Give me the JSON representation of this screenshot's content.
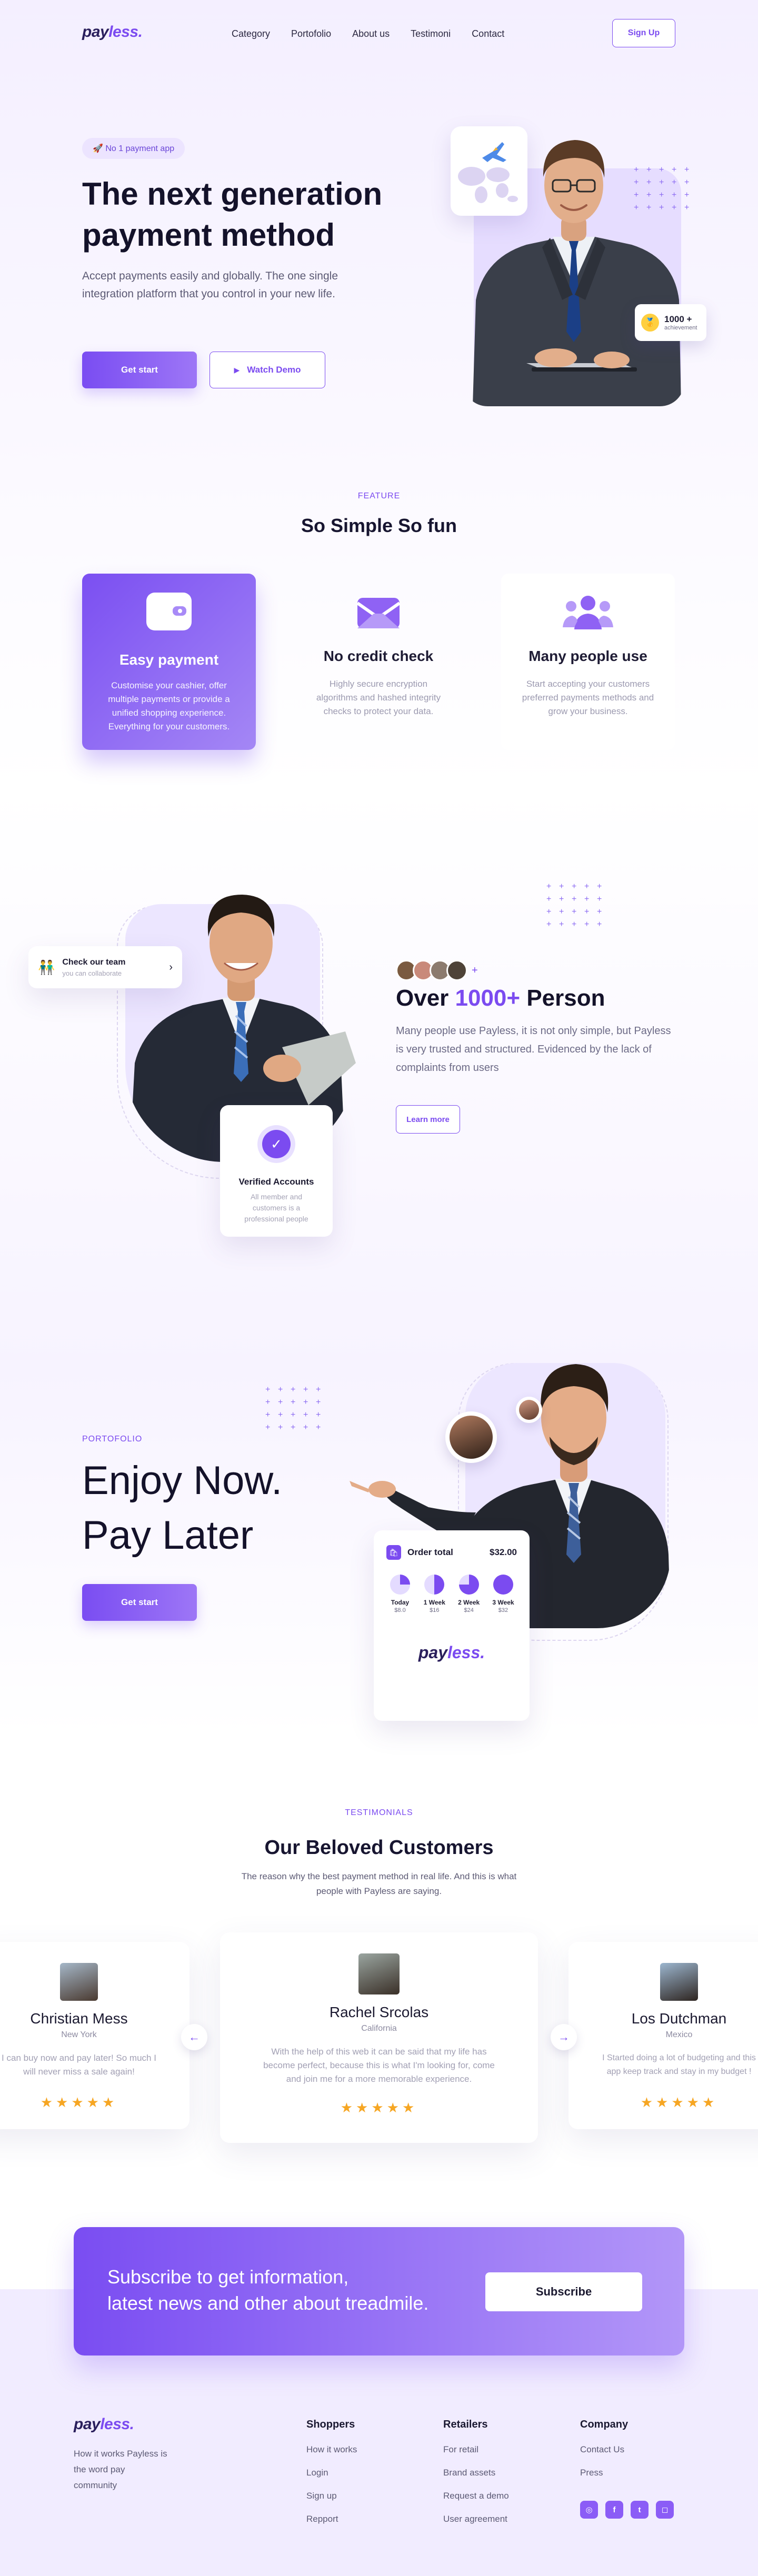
{
  "nav": {
    "logo_main": "pay",
    "logo_accent": "less.",
    "links": [
      "Category",
      "Portofolio",
      "About us",
      "Testimoni",
      "Contact"
    ],
    "signup": "Sign Up"
  },
  "hero": {
    "badge": "🚀 No 1 payment app",
    "title_line1": "The next generation",
    "title_line2": "payment method",
    "lead": "Accept payments easily and globally. The one single integration platform that you control in your new life.",
    "get_start": "Get start",
    "watch_demo": "Watch Demo",
    "achievement_value": "1000 +",
    "achievement_label": "achievement"
  },
  "feature": {
    "eyebrow": "FEATURE",
    "title": "So Simple So fun",
    "cards": [
      {
        "title": "Easy payment",
        "text": "Customise your cashier, offer multiple payments or provide a unified shopping experience. Everything for your customers."
      },
      {
        "title": "No credit check",
        "text": "Highly secure encryption algorithms and hashed integrity checks to protect your data."
      },
      {
        "title": "Many people use",
        "text": "Start accepting your customers preferred payments methods and grow your business."
      }
    ]
  },
  "team": {
    "check_title": "Check our team",
    "check_sub": "you can collaborate",
    "verified_title": "Verified Accounts",
    "verified_text": "All member and customers is a professional people",
    "heading_pre": "Over ",
    "heading_accent": "1000+",
    "heading_post": " Person",
    "text": "Many people use Payless, it is not only simple, but Payless is very trusted and structured. Evidenced by the lack of complaints from users",
    "learn_more": "Learn more"
  },
  "portfolio": {
    "eyebrow": "PORTOFOLIO",
    "line1": "Enjoy Now.",
    "line2": "Pay Later",
    "get_start": "Get start",
    "order_label": "Order total",
    "order_value": "$32.00",
    "schedule": [
      {
        "label": "Today",
        "amount": "$8.0"
      },
      {
        "label": "1 Week",
        "amount": "$16"
      },
      {
        "label": "2 Week",
        "amount": "$24"
      },
      {
        "label": "3 Week",
        "amount": "$32"
      }
    ],
    "logo_main": "pay",
    "logo_accent": "less."
  },
  "testimonials": {
    "eyebrow": "TESTIMONIALS",
    "title": "Our Beloved Customers",
    "subtitle": "The reason why the best payment method in real life. And this is what people with Payless are saying.",
    "items": [
      {
        "name": "Christian Mess",
        "city": "New York",
        "text": "I can buy now and pay later! So much I will never miss a sale again!",
        "stars": "★★★★★"
      },
      {
        "name": "Rachel Srcolas",
        "city": "California",
        "text": "With the help of this web it can be said that my life has become perfect, because this is what I'm looking for, come and join me for a more memorable experience.",
        "stars": "★★★★★"
      },
      {
        "name": "Los Dutchman",
        "city": "Mexico",
        "text": "I Started doing a lot of budgeting and this app keep track and stay in my budget !",
        "stars": "★★★★★"
      }
    ]
  },
  "subscribe": {
    "text_line1": "Subscribe to get information,",
    "text_line2": "latest news and other about treadmile.",
    "button": "Subscribe"
  },
  "footer": {
    "logo_main": "pay",
    "logo_accent": "less.",
    "tagline": "How it works Payless is the word pay community",
    "shoppers_title": "Shoppers",
    "shoppers": [
      "How it works",
      "Login",
      "Sign up",
      "Repport"
    ],
    "retailers_title": "Retailers",
    "retailers": [
      "For retail",
      "Brand assets",
      "Request a demo",
      "User agreement"
    ],
    "company_title": "Company",
    "company": [
      "Contact Us",
      "Press"
    ]
  },
  "colors": {
    "accent": "#7b4bf0",
    "star": "#f6a623"
  }
}
